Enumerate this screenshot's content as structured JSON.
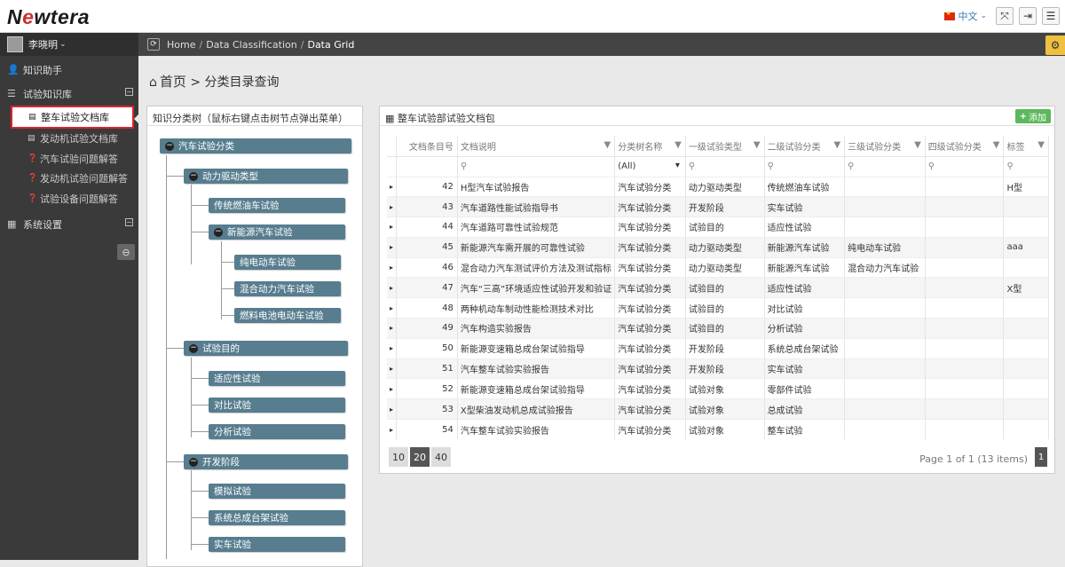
{
  "app": {
    "logo_pre": "N",
    "logo_o": "e",
    "logo_post": "wtera"
  },
  "header": {
    "language": "中文",
    "icons": [
      "fullscreen-icon",
      "logout-icon",
      "menu-icon"
    ]
  },
  "user": {
    "name": "李晓明"
  },
  "sidebar": {
    "items": [
      {
        "label": "知识助手",
        "icon": "user-icon"
      },
      {
        "label": "试验知识库",
        "icon": "list-icon",
        "collapse": "⊟",
        "children": [
          {
            "label": "整车试验文档库",
            "icon": "inbox-icon",
            "active": true
          },
          {
            "label": "发动机试验文档库",
            "icon": "inbox-icon"
          },
          {
            "label": "汽车试验问题解答",
            "icon": "question-icon"
          },
          {
            "label": "发动机试验问题解答",
            "icon": "question-icon"
          },
          {
            "label": "试验设备问题解答",
            "icon": "question-icon"
          }
        ]
      },
      {
        "label": "系统设置",
        "icon": "file-icon",
        "collapse": "⊟"
      }
    ]
  },
  "breadcrumb": {
    "items": [
      "Home",
      "Data Classification",
      "Data Grid"
    ]
  },
  "page": {
    "title_home": "首页",
    "title_rest": " > 分类目录查询"
  },
  "tree": {
    "title": "知识分类树（鼠标右键点击树节点弹出菜单）",
    "nodes": {
      "root": "汽车试验分类",
      "power": "动力驱动类型",
      "fuel": "传统燃油车试验",
      "nev": "新能源汽车试验",
      "ev": "纯电动车试验",
      "hybrid": "混合动力汽车试验",
      "fcev": "燃料电池电动车试验",
      "purpose": "试验目的",
      "adapt": "适应性试验",
      "compare": "对比试验",
      "analysis": "分析试验",
      "dev": "开发阶段",
      "sim": "模拟试验",
      "bench": "系统总成台架试验",
      "real": "实车试验"
    }
  },
  "grid": {
    "title": "整车试验部试验文档包",
    "add_label": "添加",
    "columns": [
      "文档条目号",
      "文档说明",
      "分类树名称",
      "一级试验类型",
      "二级试验分类",
      "三级试验分类",
      "四级试验分类",
      "标签"
    ],
    "filter_all": "(All)",
    "rows": [
      {
        "id": "42",
        "desc": "H型汽车试验报告",
        "tree": "汽车试验分类",
        "l1": "动力驱动类型",
        "l2": "传统燃油车试验",
        "l3": "",
        "l4": "",
        "tag": "H型"
      },
      {
        "id": "43",
        "desc": "汽车道路性能试验指导书",
        "tree": "汽车试验分类",
        "l1": "开发阶段",
        "l2": "实车试验",
        "l3": "",
        "l4": "",
        "tag": ""
      },
      {
        "id": "44",
        "desc": "汽车道路可靠性试验规范",
        "tree": "汽车试验分类",
        "l1": "试验目的",
        "l2": "适应性试验",
        "l3": "",
        "l4": "",
        "tag": ""
      },
      {
        "id": "45",
        "desc": "新能源汽车需开展的可靠性试验",
        "tree": "汽车试验分类",
        "l1": "动力驱动类型",
        "l2": "新能源汽车试验",
        "l3": "纯电动车试验",
        "l4": "",
        "tag": "aaa"
      },
      {
        "id": "46",
        "desc": "混合动力汽车测试评价方法及测试指标",
        "tree": "汽车试验分类",
        "l1": "动力驱动类型",
        "l2": "新能源汽车试验",
        "l3": "混合动力汽车试验",
        "l4": "",
        "tag": ""
      },
      {
        "id": "47",
        "desc": "汽车“三高”环境适应性试验开发和验证",
        "tree": "汽车试验分类",
        "l1": "试验目的",
        "l2": "适应性试验",
        "l3": "",
        "l4": "",
        "tag": "X型"
      },
      {
        "id": "48",
        "desc": "两种机动车制动性能检测技术对比",
        "tree": "汽车试验分类",
        "l1": "试验目的",
        "l2": "对比试验",
        "l3": "",
        "l4": "",
        "tag": ""
      },
      {
        "id": "49",
        "desc": "汽车构造实验报告",
        "tree": "汽车试验分类",
        "l1": "试验目的",
        "l2": "分析试验",
        "l3": "",
        "l4": "",
        "tag": ""
      },
      {
        "id": "50",
        "desc": "新能源变速箱总成台架试验指导",
        "tree": "汽车试验分类",
        "l1": "开发阶段",
        "l2": "系统总成台架试验",
        "l3": "",
        "l4": "",
        "tag": ""
      },
      {
        "id": "51",
        "desc": "汽车整车试验实验报告",
        "tree": "汽车试验分类",
        "l1": "开发阶段",
        "l2": "实车试验",
        "l3": "",
        "l4": "",
        "tag": ""
      },
      {
        "id": "52",
        "desc": "新能源变速箱总成台架试验指导",
        "tree": "汽车试验分类",
        "l1": "试验对象",
        "l2": "零部件试验",
        "l3": "",
        "l4": "",
        "tag": ""
      },
      {
        "id": "53",
        "desc": "X型柴油发动机总成试验报告",
        "tree": "汽车试验分类",
        "l1": "试验对象",
        "l2": "总成试验",
        "l3": "",
        "l4": "",
        "tag": ""
      },
      {
        "id": "54",
        "desc": "汽车整车试验实验报告",
        "tree": "汽车试验分类",
        "l1": "试验对象",
        "l2": "整车试验",
        "l3": "",
        "l4": "",
        "tag": ""
      }
    ],
    "page_sizes": [
      "10",
      "20",
      "40"
    ],
    "page_size_selected": "20",
    "page_info": "Page 1 of 1 (13 items)",
    "current_page": "1"
  }
}
